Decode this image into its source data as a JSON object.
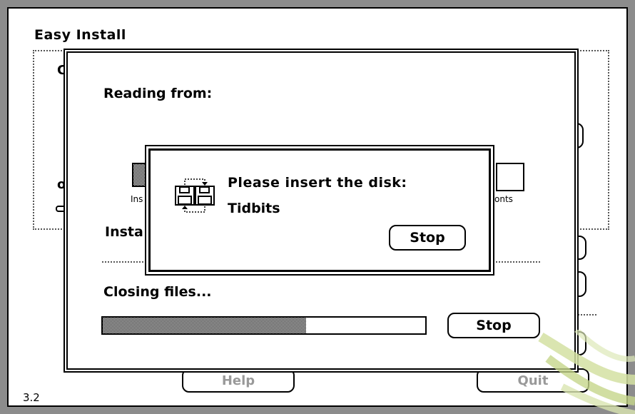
{
  "main_window": {
    "title": "Easy Install",
    "bg_letter_top": "C",
    "bg_letter_bottom": "o",
    "version": "3.2",
    "help_button": "Help",
    "quit_button": "Quit"
  },
  "progress_dialog": {
    "reading_label": "Reading from:",
    "install_label": "Insta",
    "installer_icon_label": "Ins",
    "fonts_icon_label": "onts",
    "status_text": "Closing files...",
    "progress": 0.63,
    "stop_button": "Stop"
  },
  "alert": {
    "icon": "disk-swap-icon",
    "line1": "Please insert the disk:",
    "disk_name": "Tidbits",
    "stop_button": "Stop"
  },
  "colors": {
    "screen_bg": "#8c8c8c",
    "watermark": "#c9d98a"
  }
}
